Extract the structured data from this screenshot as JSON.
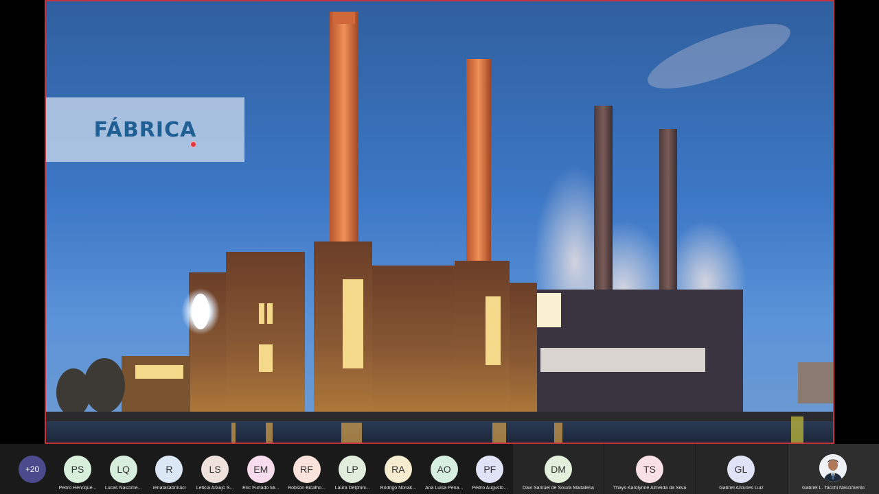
{
  "slide": {
    "title": "FÁBRICA"
  },
  "more_participants": "+20",
  "participants": [
    {
      "initials": "PS",
      "name": "Pedro Henrique...",
      "color": "#d8efdc"
    },
    {
      "initials": "LQ",
      "name": "Lucas Nascime...",
      "color": "#d8eedd"
    },
    {
      "initials": "R",
      "name": "renatasabrinacl",
      "color": "#dbe7f5"
    },
    {
      "initials": "LS",
      "name": "Leticia Araujo S...",
      "color": "#efe2dc"
    },
    {
      "initials": "EM",
      "name": "Eric Furtado Mi...",
      "color": "#f6dcec"
    },
    {
      "initials": "RF",
      "name": "Robson Bicalho...",
      "color": "#f9e3db"
    },
    {
      "initials": "LP",
      "name": "Laura Delphini...",
      "color": "#e1eedd"
    },
    {
      "initials": "RA",
      "name": "Rodrigo Nonak...",
      "color": "#f6ecd0"
    },
    {
      "initials": "AO",
      "name": "Ana Luisa Pena...",
      "color": "#d6efe0"
    },
    {
      "initials": "PF",
      "name": "Pedro Augusto...",
      "color": "#dfe3f5"
    }
  ],
  "featured_participants": [
    {
      "initials": "DM",
      "name": "Davi Samuel de Souza Madalena",
      "color": "#e2f0dc"
    },
    {
      "initials": "TS",
      "name": "Thays Karolynne Almeida da Silva",
      "color": "#f9dfe6"
    },
    {
      "initials": "GL",
      "name": "Gabriel Antunes Luiz",
      "color": "#dfe3f5"
    }
  ],
  "speaker": {
    "name": "Gabriel L. Tacchi Nascimento"
  }
}
